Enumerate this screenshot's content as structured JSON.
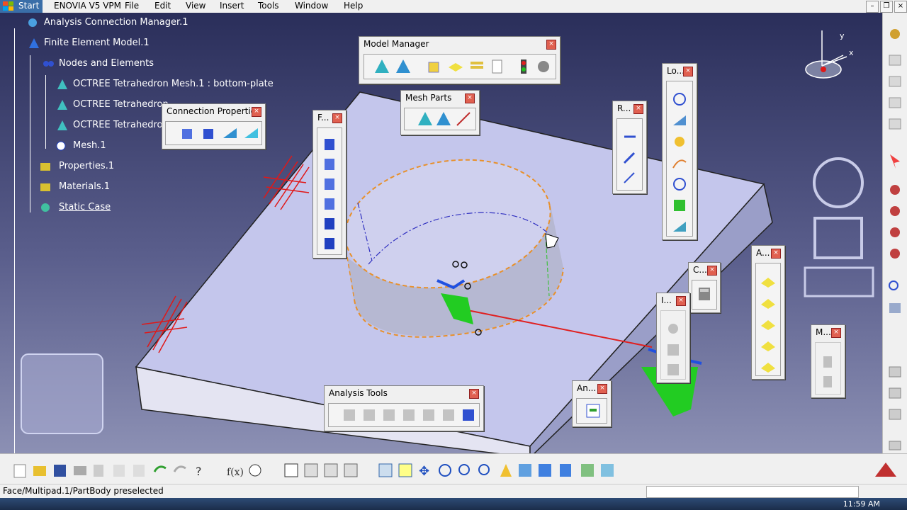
{
  "menubar": {
    "start": "Start",
    "items": [
      "ENOVIA V5 VPM",
      "File",
      "Edit",
      "View",
      "Insert",
      "Tools",
      "Window",
      "Help"
    ]
  },
  "tree": {
    "items": [
      "Analysis Connection Manager.1",
      "Finite Element Model.1",
      "Nodes and Elements",
      "OCTREE Tetrahedron Mesh.1 : bottom-plate",
      "OCTREE Tetrahedron",
      "OCTREE Tetrahedron",
      "Mesh.1",
      "Properties.1",
      "Materials.1",
      "Static Case"
    ]
  },
  "toolbars": {
    "model_manager": "Model Manager",
    "mesh_parts": "Mesh Parts",
    "connection_properties": "Connection Properties",
    "f": "F...",
    "r": "R...",
    "lo": "Lo...",
    "c": "C...",
    "a": "A...",
    "i": "I...",
    "m": "M...",
    "an": "An...",
    "analysis_tools": "Analysis Tools",
    "close_glyph": "×"
  },
  "compass": {
    "x": "x",
    "y": "y"
  },
  "status": {
    "text": "Face/Multipad.1/PartBody preselected"
  },
  "taskbar": {
    "clock": "11:59 AM"
  },
  "colors": {
    "viewport_top": "#2a2e5a",
    "viewport_bottom": "#8c90b4",
    "selection": "#e8a040",
    "highlight": "#22cc22"
  }
}
